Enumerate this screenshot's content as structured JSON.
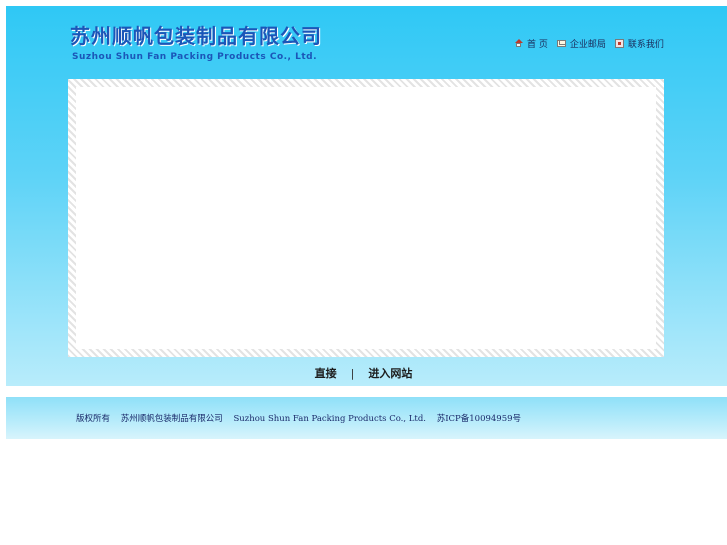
{
  "logo": {
    "name_cn": "苏州顺帆包装制品有限公司",
    "name_en": "Suzhou Shun Fan Packing Products Co., Ltd."
  },
  "topnav": {
    "items": [
      {
        "label": "首 页",
        "icon": "home-icon"
      },
      {
        "label": "企业邮局",
        "icon": "mail-icon"
      },
      {
        "label": "联系我们",
        "icon": "contact-icon"
      }
    ]
  },
  "enter_bar": {
    "direct_label": "直接",
    "separator": "|",
    "enter_label": "进入网站"
  },
  "footer": {
    "copyright_label": "版权所有",
    "company_cn": "苏州顺帆包装制品有限公司",
    "company_en": "Suzhou Shun Fan Packing Products Co., Ltd.",
    "icp": "苏ICP备10094959号"
  },
  "colors": {
    "header_top": "#2fc8f5",
    "header_bottom": "#b8ecfb",
    "logo_text": "#1b56b8"
  }
}
